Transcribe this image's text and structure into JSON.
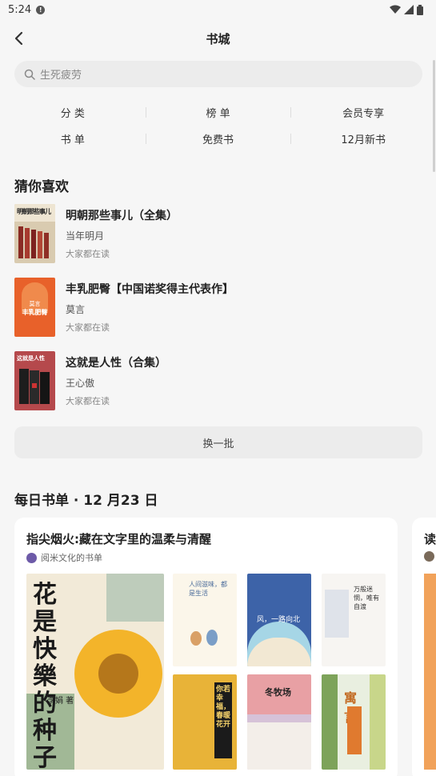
{
  "status": {
    "time": "5:24"
  },
  "header": {
    "title": "书城"
  },
  "search": {
    "placeholder": "生死疲劳"
  },
  "categories": [
    [
      "分 类",
      "榜 单",
      "会员专享"
    ],
    [
      "书 单",
      "免费书",
      "12月新书"
    ]
  ],
  "guess": {
    "title": "猜你喜欢",
    "books": [
      {
        "title": "明朝那些事儿（全集）",
        "author": "当年明月",
        "meta": "大家都在读",
        "cover_text": "明朝那些事儿"
      },
      {
        "title": "丰乳肥臀【中国诺奖得主代表作】",
        "author": "莫言",
        "meta": "大家都在读",
        "cover_text": "丰乳肥臀",
        "cover_author": "莫言"
      },
      {
        "title": "这就是人性（合集）",
        "author": "王心傲",
        "meta": "大家都在读",
        "cover_text": "这就是人性"
      }
    ],
    "refresh_label": "换一批"
  },
  "daily": {
    "title": "每日书单 · 12 月23 日",
    "card_title": "指尖烟火:藏在文字里的温柔与清醒",
    "card_source": "阅米文化的书单",
    "next_card_title": "读",
    "covers": {
      "big": "花是快樂的种子",
      "big_author": "李娟 著",
      "b1": "人间滋味，都是生活",
      "b2": "风，一路向北",
      "b3": "万般迷惘，唯有自渡",
      "b4": "你若幸福，春暖花开",
      "b5": "冬牧场",
      "b6": "寓言"
    }
  }
}
